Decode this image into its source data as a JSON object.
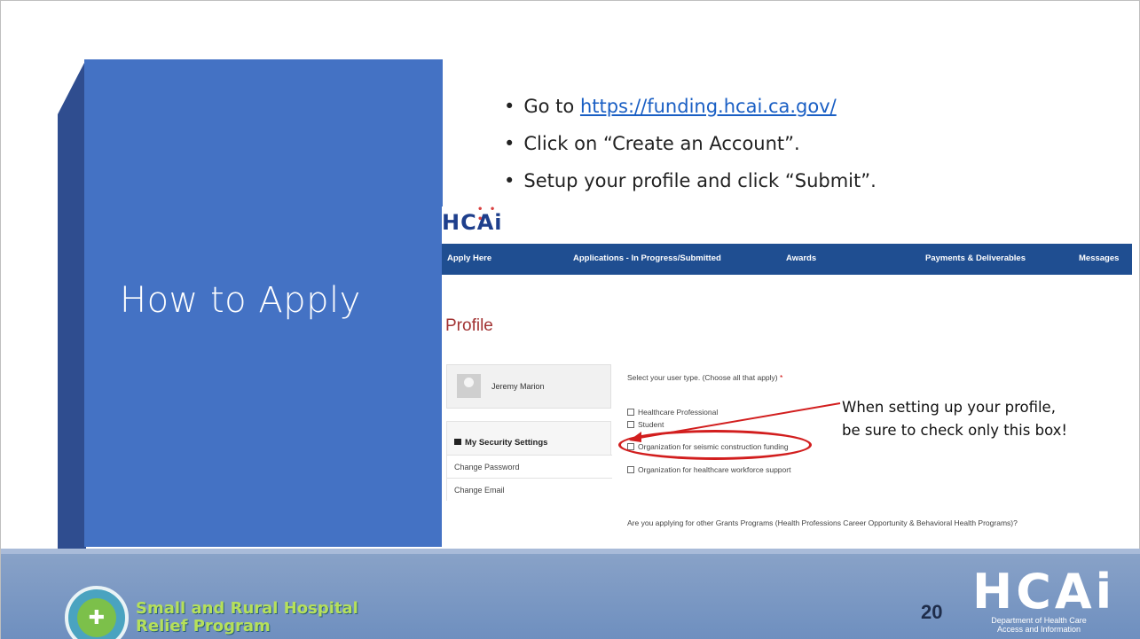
{
  "slide": {
    "title": "How to Apply",
    "page_number": "20",
    "colors": {
      "panel": "#4472c4",
      "footer": "#7a97c4",
      "link": "#1a5fc4",
      "highlight": "#d21e1e"
    }
  },
  "bullets": {
    "item1_prefix": "Go to ",
    "item1_link": "https://funding.hcai.ca.gov/",
    "item2": "Click on “Create an Account”.",
    "item3": "Setup your profile and click “Submit”."
  },
  "embed": {
    "logo": "HCAi",
    "nav": [
      "Apply Here",
      "Applications - In Progress/Submitted",
      "Awards",
      "Payments & Deliverables",
      "Messages"
    ],
    "profile_heading": "Profile",
    "user_name": "Jeremy Marion",
    "security": {
      "title": "My Security Settings",
      "items": [
        "Change Password",
        "Change Email"
      ]
    },
    "form": {
      "question": "Select your user type. (Choose all that apply)",
      "required_mark": "*",
      "options": [
        "Healthcare Professional",
        "Student",
        "Organization for seismic construction funding",
        "Organization for healthcare workforce support"
      ],
      "question2": "Are you applying for other Grants Programs (Health Professions Career Opportunity & Behavioral Health Programs)?"
    }
  },
  "annotation": {
    "line1": "When setting up your profile,",
    "line2": "be sure to check only this box!"
  },
  "footer": {
    "program_line1": "Small and Rural Hospital",
    "program_line2": "Relief Program",
    "hcai_logo": "HCAi",
    "hcai_dept_line1": "Department of Health Care",
    "hcai_dept_line2": "Access and Information"
  }
}
